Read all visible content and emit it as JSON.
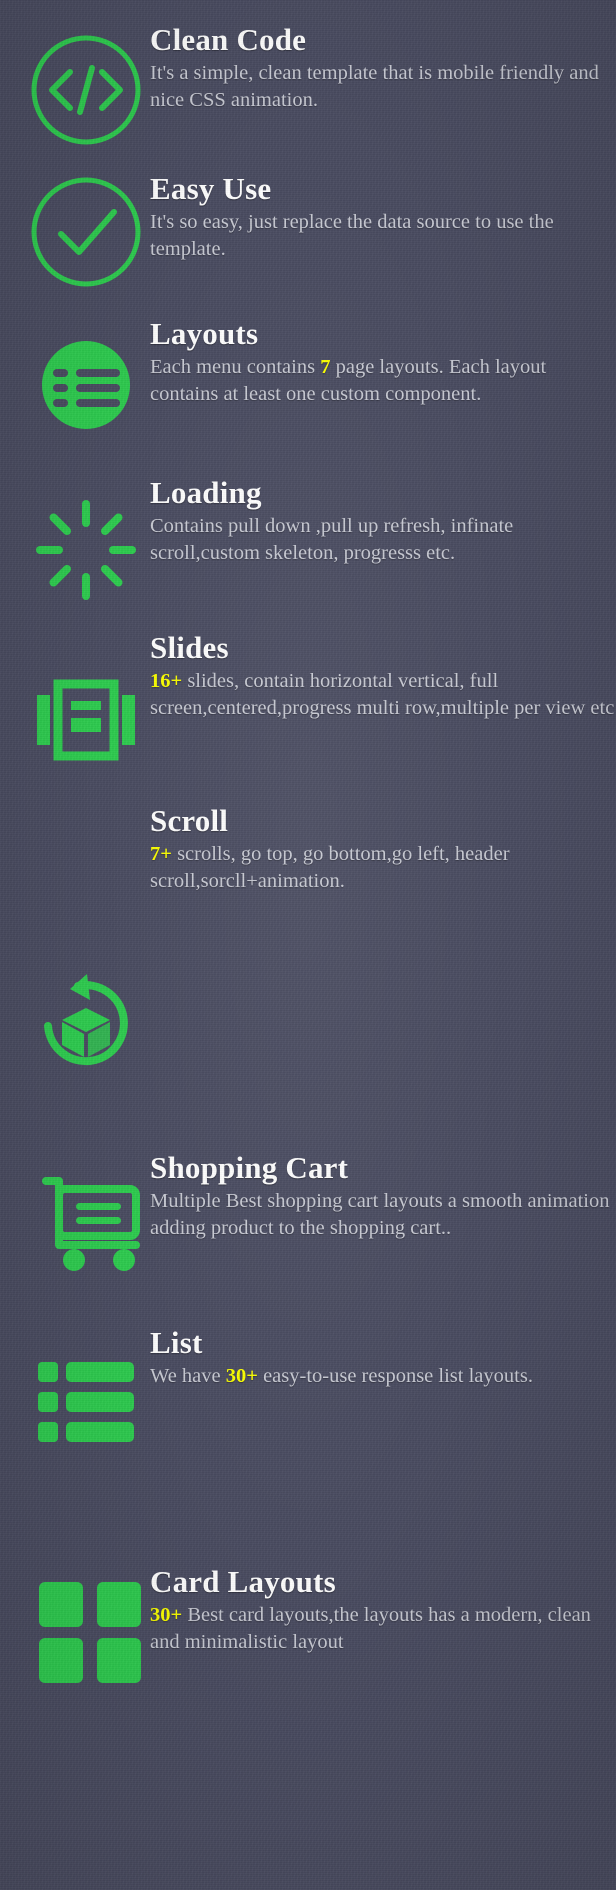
{
  "theme": {
    "background_color": "#4a4c61",
    "accent_color": "#2ecc4f",
    "title_color": "#ffffff",
    "body_color": "#c9cbd4",
    "highlight_color": "#fbff00"
  },
  "features": [
    {
      "icon": "code-icon",
      "title": "Clean Code",
      "desc_pre": "It's a simple, clean template that is mobile friendly and nice CSS animation.",
      "highlight": "",
      "desc_post": ""
    },
    {
      "icon": "check-circle-icon",
      "title": "Easy Use",
      "desc_pre": "It's so easy, just replace the data source to use the template.",
      "highlight": "",
      "desc_post": ""
    },
    {
      "icon": "list-circle-icon",
      "title": "Layouts",
      "desc_pre": "Each menu contains ",
      "highlight": "7",
      "desc_post": " page layouts. Each layout contains at least one custom component."
    },
    {
      "icon": "spinner-icon",
      "title": "Loading",
      "desc_pre": "Contains pull down ,pull up refresh, infinate scroll,custom skeleton, progresss etc.",
      "highlight": "",
      "desc_post": ""
    },
    {
      "icon": "slides-icon",
      "title": "Slides",
      "desc_pre": "",
      "highlight": "16+",
      "desc_post": " slides, contain horizontal vertical, full screen,centered,progress multi row,multiple per view etc"
    },
    {
      "icon": "scroll-cube-icon",
      "title": "Scroll",
      "desc_pre": "",
      "highlight": "7+",
      "desc_post": " scrolls, go top, go bottom,go left, header scroll,sorcll+animation."
    },
    {
      "icon": "shopping-cart-icon",
      "title": "Shopping Cart",
      "desc_pre": "Multiple Best shopping cart layouts a smooth animation adding product to the shopping cart..",
      "highlight": "",
      "desc_post": ""
    },
    {
      "icon": "list-bars-icon",
      "title": "List",
      "desc_pre": "We have ",
      "highlight": "30+",
      "desc_post": " easy-to-use response list layouts."
    },
    {
      "icon": "card-grid-icon",
      "title": "Card Layouts",
      "desc_pre": "",
      "highlight": "30+",
      "desc_post": "  Best card layouts,the layouts has a modern, clean and minimalistic layout"
    }
  ]
}
